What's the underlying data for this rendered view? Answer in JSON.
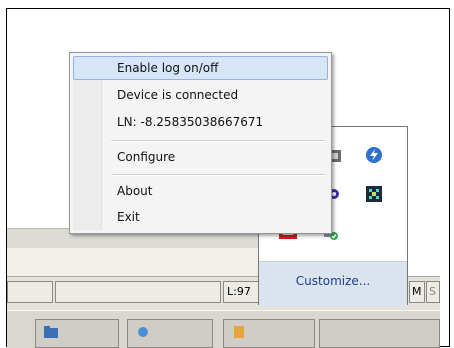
{
  "context_menu": {
    "items": [
      {
        "label": "Enable log on/off",
        "highlighted": true
      },
      {
        "label": "Device is connected"
      },
      {
        "label": "LN: -8.25835038667671"
      },
      {
        "label": "Configure"
      },
      {
        "label": "About"
      },
      {
        "label": "Exit"
      }
    ]
  },
  "tray_overflow": {
    "customize_label": "Customize...",
    "icons": [
      "app-tray-icon",
      "lightning-icon",
      "eye-icon",
      "grid-icon",
      "red-app-icon",
      "network-check-icon"
    ]
  },
  "status_bar": {
    "line_field": "L:97",
    "field_m": "M",
    "field_s": "S"
  },
  "colors": {
    "menu_highlight": "#d6e6f8",
    "customize_link": "#1a3f86"
  }
}
